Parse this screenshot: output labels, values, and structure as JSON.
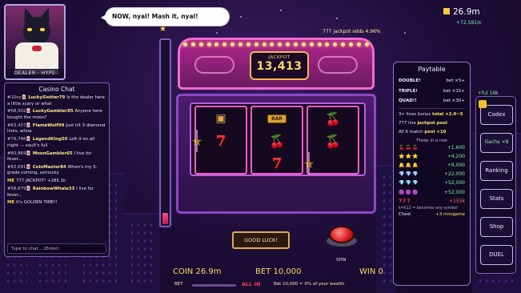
{
  "dealer": {
    "caption": "DEALER · HYPE"
  },
  "bubble": {
    "text": "NOW, nyal! Mash it, nyal!"
  },
  "jackpot": {
    "odds_text": "777 jackpot odds 4.96%",
    "label": "JACKPOT",
    "value": "13,413"
  },
  "chat": {
    "title": "Casino Chat",
    "messages": [
      {
        "rank": "#10ᴋɢ🀄",
        "user": "LuckySlotter79",
        "text": "Is the dealer here a little scary or what"
      },
      {
        "rank": "#68,902🀄",
        "user": "LuckyGambler85",
        "text": "Anyone here bought the moon?"
      },
      {
        "rank": "#63,437🀄",
        "user": "FlameWolf99",
        "text": "Just hit 3 diamond lines, whoa"
      },
      {
        "rank": "#76,746🀄",
        "user": "LegendKing50",
        "text": "Left it on all night — vault's full"
      },
      {
        "rank": "#60,869🀄",
        "user": "MoonGambler65",
        "text": "I live for fever..."
      },
      {
        "rank": "#82,691🀄",
        "user": "CoinMaster84",
        "text": "When's my S-grade coming, seriously"
      },
      {
        "rank": "",
        "user": "ME",
        "text": "777 JACKPOT! +285.1k",
        "me": true
      },
      {
        "rank": "#58,679🀄",
        "user": "RainbowWhale33",
        "text": "I live for fever..."
      },
      {
        "rank": "",
        "user": "ME",
        "text": "It's GOLDEN TIME!!",
        "me": true
      }
    ],
    "input_placeholder": "Type to chat... (Enter)"
  },
  "meter": {
    "level": 0.06
  },
  "reels": [
    [
      "chest",
      "star",
      "seven"
    ],
    [
      "bar",
      "cherry",
      "seven"
    ],
    [
      "cherry",
      "cherry",
      "star"
    ]
  ],
  "controls": {
    "status_text": "GOOD LUCK!",
    "spin_label": "SPIN"
  },
  "bottom": {
    "coin_label": "COIN 26.9m",
    "bet_label": "BET 10,000",
    "win_label": "WIN 0",
    "bet_caption": "BET",
    "allin_label": "ALL IN",
    "bet_note": "Bet 10,000 = 0% of your wealth"
  },
  "wallet": {
    "balance": "26.9m",
    "rate": "+72,581/s"
  },
  "paytable": {
    "title": "Paytable",
    "multipliers": [
      {
        "name": "DOUBLE!",
        "value": "bet ×5+"
      },
      {
        "name": "TRIPLE!",
        "value": "bet ×15+"
      },
      {
        "name": "QUAD!!",
        "value": "bet ×30+"
      }
    ],
    "lines": [
      {
        "text": "3+ lines bonus",
        "highlight": "total ×2.0~5"
      },
      {
        "text": "777 line",
        "highlight": "jackpot pool"
      },
      {
        "text": "All 9 match",
        "highlight": "pool ×10"
      }
    ],
    "sub_title": "Three in a row",
    "combos": [
      {
        "syms": "🍒🍒🍒",
        "payout": "+1,600"
      },
      {
        "syms": "⭐⭐⭐",
        "payout": "+4,200"
      },
      {
        "syms": "🔔🔔🔔",
        "payout": "+9,000"
      },
      {
        "syms": "💎💎💎",
        "payout": "+22,000"
      },
      {
        "syms": "💎💎💎",
        "payout": "+52,000"
      },
      {
        "syms": "🟣🟣🟣",
        "payout": "+52,000"
      },
      {
        "syms": "777",
        "payout": "+155k",
        "red": true
      }
    ],
    "footnote": "k=k12 = becomes any symbol",
    "chest_label": "Chest",
    "chest_value": "+3 minigame"
  },
  "sidemenu": {
    "xp": "+ful 16k",
    "items": [
      "Codex",
      "Gacha ×8",
      "Ranking",
      "Stats",
      "Shop",
      "DUEL"
    ]
  }
}
